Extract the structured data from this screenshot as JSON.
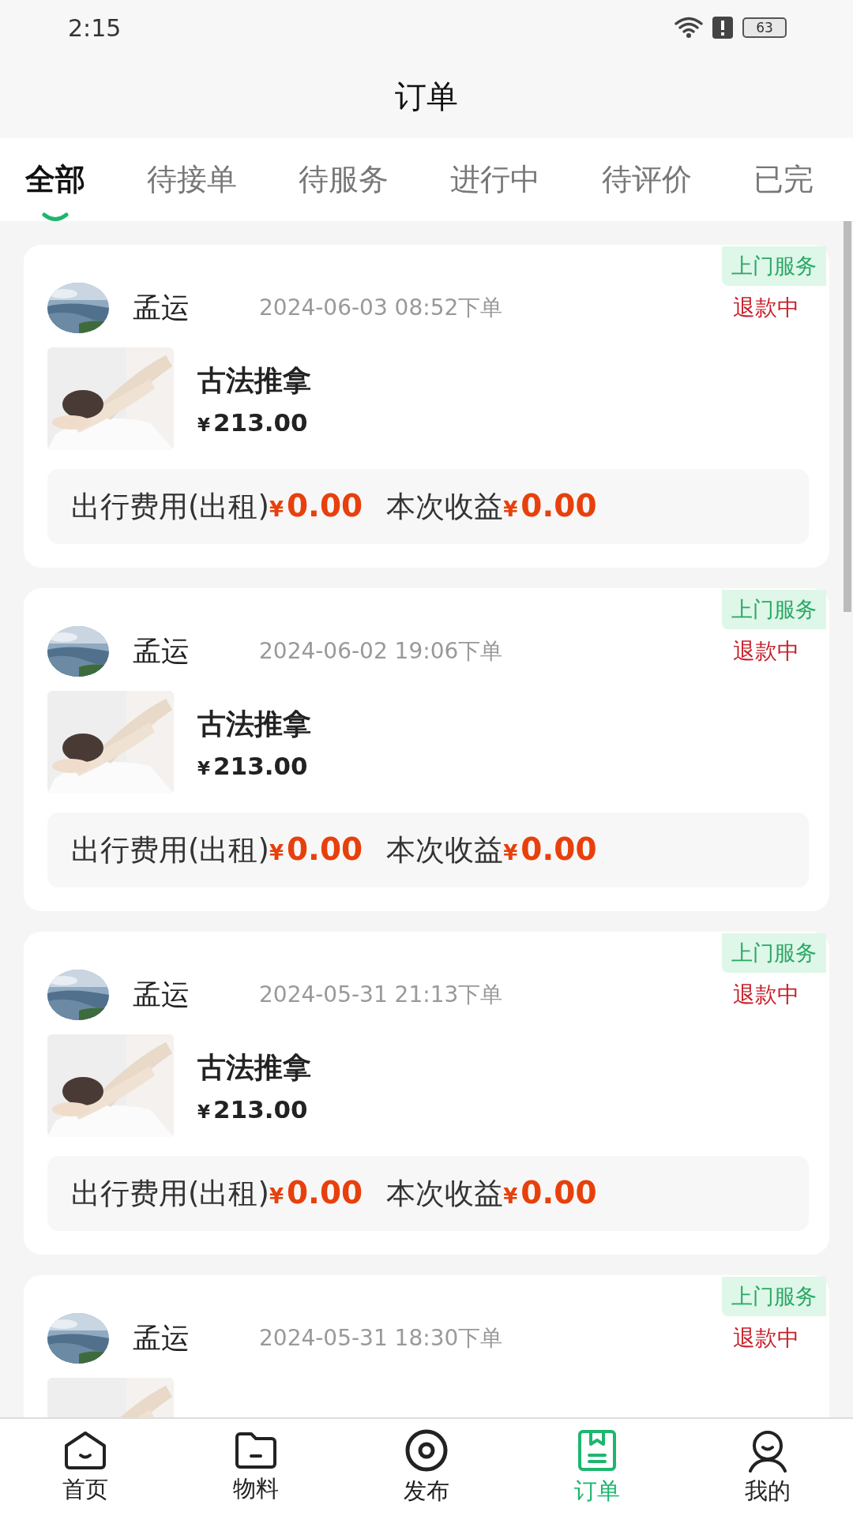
{
  "status_bar": {
    "time": "2:15",
    "battery": "63"
  },
  "title": "订单",
  "tabs": [
    {
      "label": "全部",
      "selected": true
    },
    {
      "label": "待接单",
      "selected": false
    },
    {
      "label": "待服务",
      "selected": false
    },
    {
      "label": "进行中",
      "selected": false
    },
    {
      "label": "待评价",
      "selected": false
    },
    {
      "label": "已完",
      "selected": false
    }
  ],
  "orders": [
    {
      "tag": "上门服务",
      "name": "孟运",
      "date": "2024-06-03 08:52下单",
      "status": "退款中",
      "product": "古法推拿",
      "currency": "¥",
      "price": "213.00",
      "fees": [
        {
          "label": "出行费用(出租)",
          "currency": "¥",
          "amount": "0.00"
        },
        {
          "label": "本次收益",
          "currency": "¥",
          "amount": "0.00"
        }
      ]
    },
    {
      "tag": "上门服务",
      "name": "孟运",
      "date": "2024-06-02 19:06下单",
      "status": "退款中",
      "product": "古法推拿",
      "currency": "¥",
      "price": "213.00",
      "fees": [
        {
          "label": "出行费用(出租)",
          "currency": "¥",
          "amount": "0.00"
        },
        {
          "label": "本次收益",
          "currency": "¥",
          "amount": "0.00"
        }
      ]
    },
    {
      "tag": "上门服务",
      "name": "孟运",
      "date": "2024-05-31 21:13下单",
      "status": "退款中",
      "product": "古法推拿",
      "currency": "¥",
      "price": "213.00",
      "fees": [
        {
          "label": "出行费用(出租)",
          "currency": "¥",
          "amount": "0.00"
        },
        {
          "label": "本次收益",
          "currency": "¥",
          "amount": "0.00"
        }
      ]
    },
    {
      "tag": "上门服务",
      "name": "孟运",
      "date": "2024-05-31 18:30下单",
      "status": "退款中"
    }
  ],
  "nav": [
    {
      "kind": "home",
      "label": "首页",
      "selected": false
    },
    {
      "kind": "folder",
      "label": "物料",
      "selected": false
    },
    {
      "kind": "publish",
      "label": "发布",
      "selected": false
    },
    {
      "kind": "orders",
      "label": "订单",
      "selected": true
    },
    {
      "kind": "profile",
      "label": "我的",
      "selected": false
    }
  ]
}
